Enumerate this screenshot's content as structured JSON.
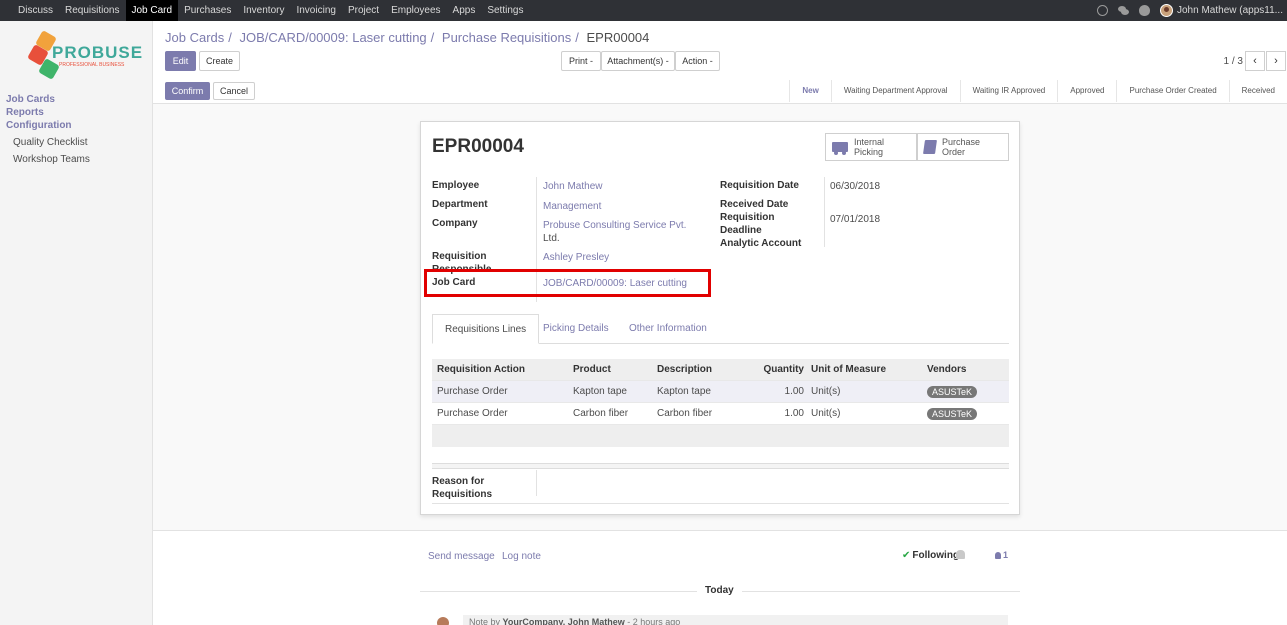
{
  "topbar": {
    "menu": [
      "Discuss",
      "Requisitions",
      "Job Card",
      "Purchases",
      "Inventory",
      "Invoicing",
      "Project",
      "Employees",
      "Apps",
      "Settings"
    ],
    "active_index": 2,
    "user": "John Mathew (apps11..."
  },
  "sidebar": {
    "logo_text": "PROBUSE",
    "logo_tagline": "PROFESSIONAL BUSINESS",
    "sections": [
      "Job Cards",
      "Reports",
      "Configuration"
    ],
    "sub_items": [
      "Quality Checklist",
      "Workshop Teams"
    ]
  },
  "breadcrumb": {
    "items": [
      "Job Cards",
      "JOB/CARD/00009: Laser cutting",
      "Purchase Requisitions"
    ],
    "current": "EPR00004"
  },
  "actions": {
    "edit": "Edit",
    "create": "Create",
    "print": "Print -",
    "attachments": "Attachment(s) -",
    "action": "Action -",
    "confirm": "Confirm",
    "cancel": "Cancel"
  },
  "pager": {
    "text": "1 / 3",
    "prev": "‹",
    "next": "›"
  },
  "stages": {
    "items": [
      "New",
      "Waiting Department Approval",
      "Waiting IR Approved",
      "Approved",
      "Purchase Order Created",
      "Received"
    ],
    "active_index": 0
  },
  "form": {
    "title": "EPR00004",
    "smart_buttons": {
      "internal_picking": [
        "Internal",
        "Picking"
      ],
      "purchase_order": [
        "Purchase",
        "Order"
      ]
    },
    "left": {
      "employee_label": "Employee",
      "employee": "John Mathew",
      "department_label": "Department",
      "department": "Management",
      "company_label": "Company",
      "company_line1": "Probuse Consulting Service Pvt.",
      "company_line2": "Ltd.",
      "responsible_label_1": "Requisition",
      "responsible_label_2": "Responsible",
      "responsible": "Ashley Presley",
      "job_card_label": "Job Card",
      "job_card": "JOB/CARD/00009: Laser cutting"
    },
    "right": {
      "req_date_label": "Requisition Date",
      "req_date": "06/30/2018",
      "received_label": "Received Date",
      "deadline_label_1": "Requisition",
      "deadline_label_2": "Deadline",
      "deadline": "07/01/2018",
      "analytic_label": "Analytic Account"
    },
    "tabs": [
      "Requisitions Lines",
      "Picking Details",
      "Other Information"
    ],
    "table": {
      "headers": [
        "Requisition Action",
        "Product",
        "Description",
        "Quantity",
        "Unit of Measure",
        "Vendors"
      ],
      "rows": [
        [
          "Purchase Order",
          "Kapton tape",
          "Kapton tape",
          "1.00",
          "Unit(s)",
          "ASUSTeK"
        ],
        [
          "Purchase Order",
          "Carbon fiber",
          "Carbon fiber",
          "1.00",
          "Unit(s)",
          "ASUSTeK"
        ]
      ]
    },
    "reason_label_1": "Reason for",
    "reason_label_2": "Requisitions"
  },
  "chatter": {
    "send_message": "Send message",
    "log_note": "Log note",
    "following": "Following",
    "followers_count": "1",
    "today": "Today",
    "note_prefix": "Note by ",
    "note_author": "YourCompany, John Mathew",
    "note_time": " - 2 hours ago"
  }
}
